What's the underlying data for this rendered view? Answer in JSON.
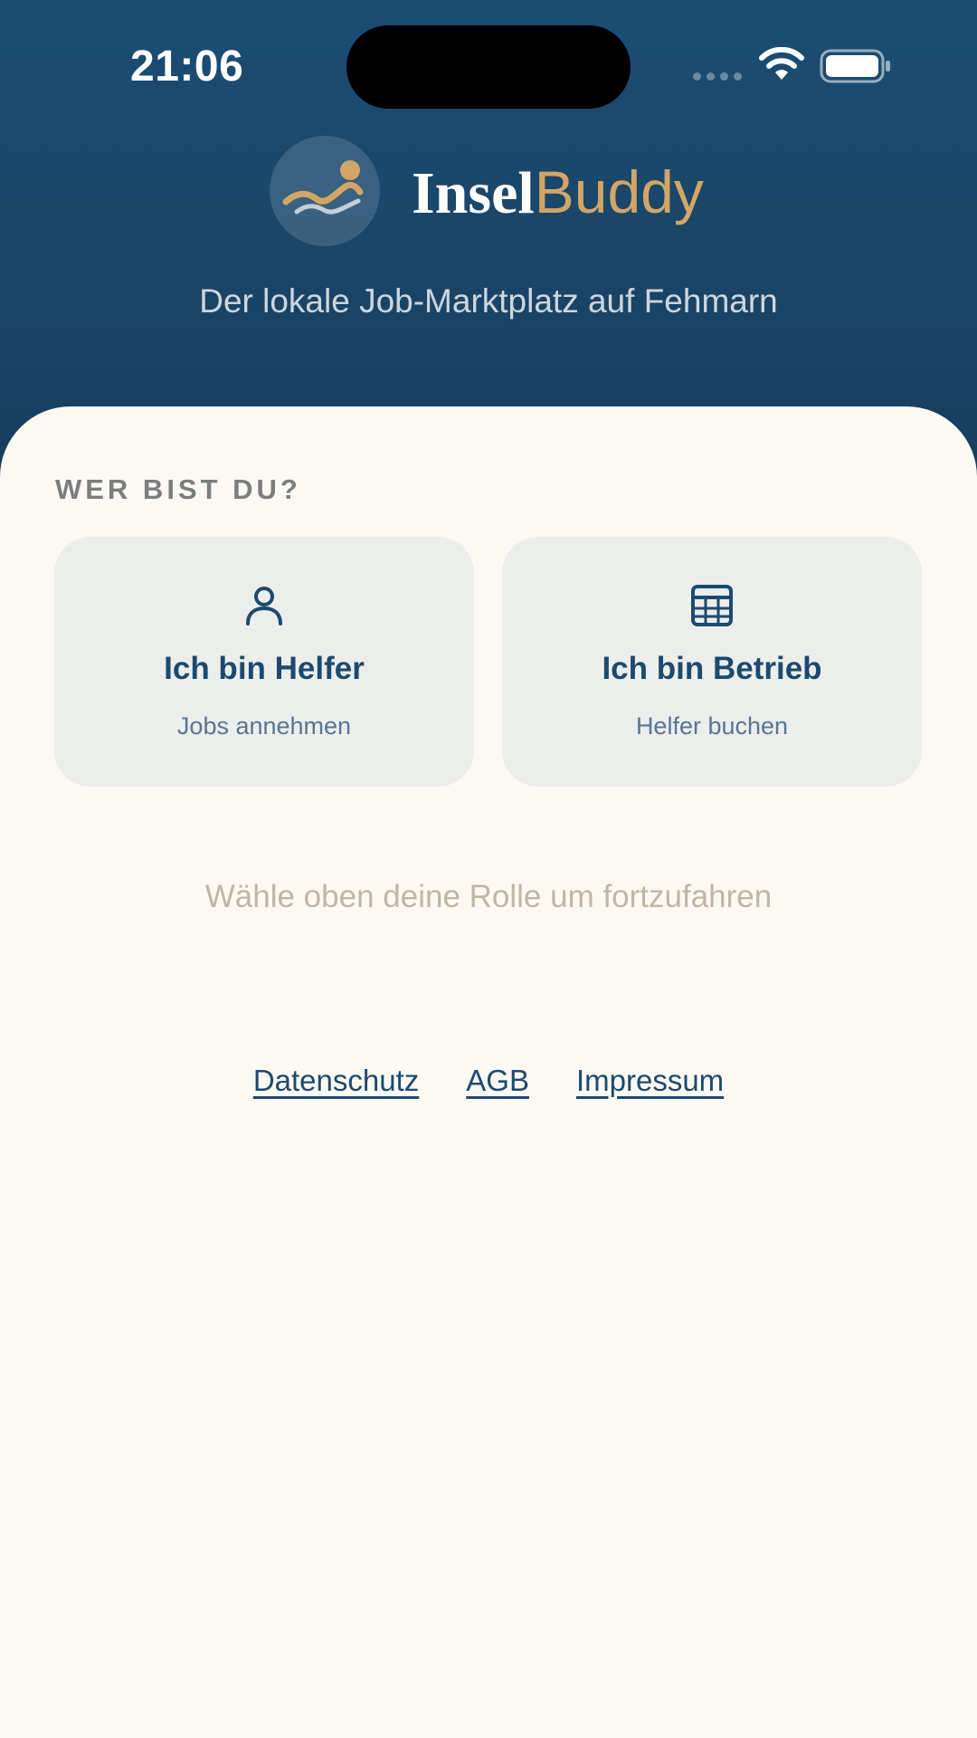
{
  "status_bar": {
    "time": "21:06"
  },
  "brand": {
    "name_first": "Insel",
    "name_second": "Buddy",
    "tagline": "Der lokale Job-Marktplatz auf Fehmarn"
  },
  "role_select": {
    "heading": "WER BIST DU?",
    "cards": [
      {
        "icon": "person-icon",
        "title": "Ich bin Helfer",
        "subtitle": "Jobs annehmen"
      },
      {
        "icon": "grid-icon",
        "title": "Ich bin Betrieb",
        "subtitle": "Helfer buchen"
      }
    ],
    "hint": "Wähle oben deine Rolle um fortzufahren"
  },
  "footer": {
    "links": [
      "Datenschutz",
      "AGB",
      "Impressum"
    ]
  },
  "colors": {
    "header_bg": "#1b4d73",
    "accent_gold": "#d3a566",
    "primary_text": "#1c4a6e",
    "sheet_bg": "#fcf9f4",
    "card_bg": "#eceeec"
  }
}
